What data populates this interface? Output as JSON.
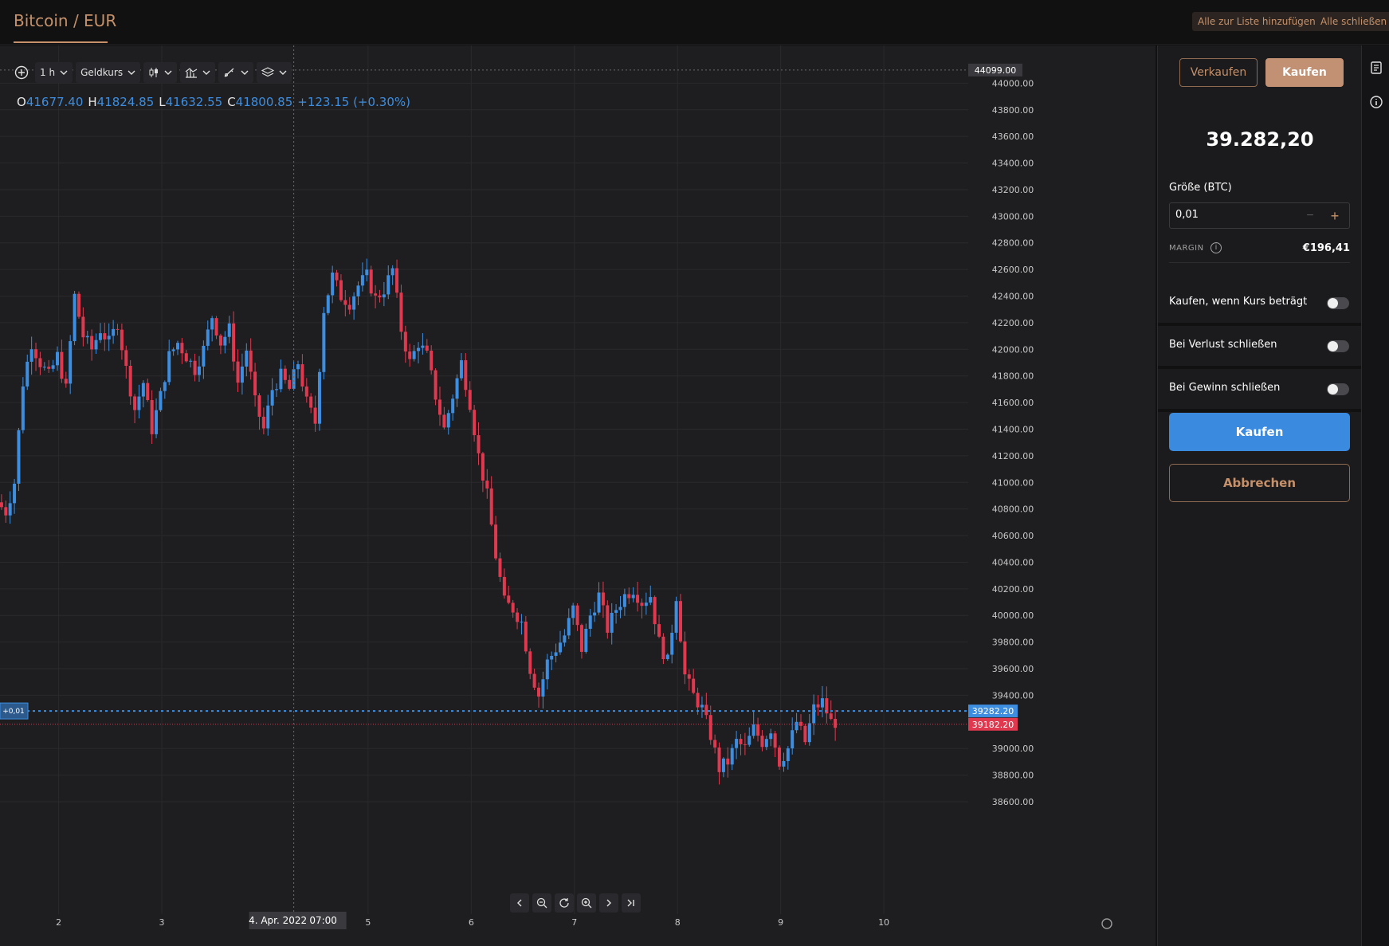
{
  "header": {
    "title": "Bitcoin / EUR",
    "add_all_label": "Alle zur Liste hinzufügen",
    "close_all_label": "Alle schließen"
  },
  "toolbar": {
    "interval": "1 h",
    "price_type": "Geldkurs",
    "icons": [
      "plus-circle-icon",
      "candles-icon",
      "indicators-icon",
      "drawing-icon",
      "layers-icon"
    ]
  },
  "ohlc": {
    "open_key": "O",
    "open": "41677.40",
    "high_key": "H",
    "high": "41824.85",
    "low_key": "L",
    "low": "41632.55",
    "close_key": "C",
    "close": "41800.85",
    "change": "+123.15 (+0.30%)"
  },
  "chart_data": {
    "type": "candlestick",
    "y_ticks": [
      "44000.00",
      "43800.00",
      "43600.00",
      "43400.00",
      "43200.00",
      "43000.00",
      "42800.00",
      "42600.00",
      "42400.00",
      "42200.00",
      "42000.00",
      "41800.00",
      "41600.00",
      "41400.00",
      "41200.00",
      "41000.00",
      "40800.00",
      "40600.00",
      "40400.00",
      "40200.00",
      "40000.00",
      "39800.00",
      "39600.00",
      "39400.00",
      "39000.00",
      "38800.00",
      "38600.00"
    ],
    "ylim": [
      38540,
      44170
    ],
    "x_ticks": [
      "2",
      "3",
      "5",
      "6",
      "7",
      "8",
      "9",
      "10"
    ],
    "x_tick_hours": [
      28.3,
      52.3,
      100.3,
      124.3,
      148.3,
      172.3,
      196.3,
      220.3
    ],
    "crosshair_label_date": "4. Apr. 2022",
    "crosshair_label_time": "07:00",
    "crosshair_price_label": "44099.00",
    "crosshair_price": 44099,
    "crosshair_hour": 83,
    "position_label": "+0,01",
    "ask_price": 39282.2,
    "ask_label": "39282.20",
    "bid_price": 39182.2,
    "bid_label": "39182.20",
    "colors": {
      "up": "#3d8ee0",
      "down": "#e0394f",
      "grid": "#2a2a2d",
      "axis_text": "#c8c8c8"
    },
    "anchors": [
      [
        0,
        40850
      ],
      [
        2,
        40780
      ],
      [
        4,
        41000
      ],
      [
        6,
        41750
      ],
      [
        8,
        42050
      ],
      [
        10,
        41900
      ],
      [
        12,
        41800
      ],
      [
        14,
        41950
      ],
      [
        16,
        41700
      ],
      [
        18,
        42400
      ],
      [
        20,
        42100
      ],
      [
        22,
        42000
      ],
      [
        24,
        42150
      ],
      [
        26,
        42050
      ],
      [
        28,
        42200
      ],
      [
        30,
        41850
      ],
      [
        32,
        41550
      ],
      [
        34,
        41750
      ],
      [
        36,
        41400
      ],
      [
        38,
        41650
      ],
      [
        40,
        41950
      ],
      [
        42,
        42050
      ],
      [
        44,
        41950
      ],
      [
        46,
        41850
      ],
      [
        48,
        42000
      ],
      [
        50,
        42250
      ],
      [
        52,
        42050
      ],
      [
        54,
        42150
      ],
      [
        56,
        41750
      ],
      [
        58,
        42000
      ],
      [
        60,
        41600
      ],
      [
        62,
        41400
      ],
      [
        64,
        41700
      ],
      [
        66,
        41800
      ],
      [
        68,
        41700
      ],
      [
        70,
        41900
      ],
      [
        72,
        41600
      ],
      [
        74,
        41450
      ],
      [
        76,
        42300
      ],
      [
        78,
        42550
      ],
      [
        80,
        42400
      ],
      [
        82,
        42350
      ],
      [
        84,
        42480
      ],
      [
        86,
        42550
      ],
      [
        88,
        42380
      ],
      [
        90,
        42450
      ],
      [
        92,
        42600
      ],
      [
        94,
        42150
      ],
      [
        96,
        41900
      ],
      [
        98,
        42050
      ],
      [
        100,
        41950
      ],
      [
        102,
        41650
      ],
      [
        104,
        41400
      ],
      [
        106,
        41650
      ],
      [
        108,
        41900
      ],
      [
        110,
        41600
      ],
      [
        112,
        41200
      ],
      [
        114,
        40900
      ],
      [
        116,
        40450
      ],
      [
        118,
        40100
      ],
      [
        120,
        40050
      ],
      [
        122,
        39950
      ],
      [
        124,
        39600
      ],
      [
        126,
        39400
      ],
      [
        128,
        39650
      ],
      [
        130,
        39750
      ],
      [
        132,
        39850
      ],
      [
        134,
        40050
      ],
      [
        136,
        39750
      ],
      [
        138,
        40000
      ],
      [
        140,
        40150
      ],
      [
        142,
        39900
      ],
      [
        144,
        40050
      ],
      [
        146,
        40150
      ],
      [
        148,
        40200
      ],
      [
        150,
        40100
      ],
      [
        152,
        40150
      ],
      [
        154,
        39800
      ],
      [
        156,
        39650
      ],
      [
        158,
        40150
      ],
      [
        160,
        39550
      ],
      [
        162,
        39400
      ],
      [
        164,
        39300
      ],
      [
        166,
        39100
      ],
      [
        168,
        38850
      ],
      [
        170,
        38900
      ],
      [
        172,
        39050
      ],
      [
        174,
        39000
      ],
      [
        176,
        39150
      ],
      [
        178,
        39050
      ],
      [
        180,
        39150
      ],
      [
        182,
        38900
      ],
      [
        184,
        39000
      ],
      [
        186,
        39200
      ],
      [
        188,
        39050
      ],
      [
        190,
        39300
      ],
      [
        192,
        39350
      ],
      [
        194,
        39200
      ]
    ]
  },
  "order": {
    "sell_tab": "Verkaufen",
    "buy_tab": "Kaufen",
    "price": "39.282,20",
    "size_label": "Größe (BTC)",
    "size_value": "0,01",
    "margin_label": "MARGIN",
    "margin_value": "€196,41",
    "toggle_limit": "Kaufen, wenn Kurs beträgt",
    "toggle_stop_loss": "Bei Verlust schließen",
    "toggle_take_profit": "Bei Gewinn schließen",
    "submit": "Kaufen",
    "cancel": "Abbrechen"
  }
}
